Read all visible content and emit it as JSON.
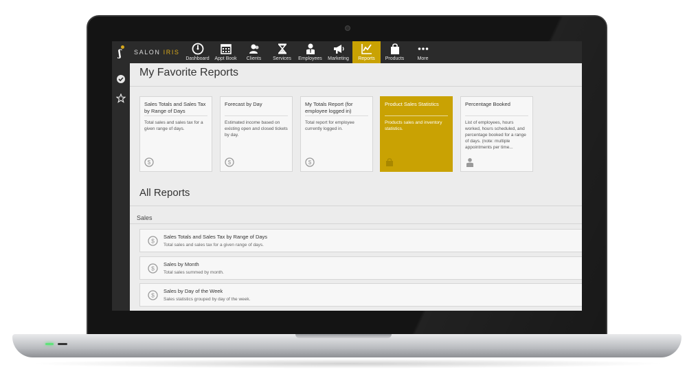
{
  "app": {
    "logo_text": "SALON",
    "logo_accent": "IRIS"
  },
  "nav": [
    {
      "label": "Dashboard",
      "icon": "dashboard-icon"
    },
    {
      "label": "Appt Book",
      "icon": "calendar-icon"
    },
    {
      "label": "Clients",
      "icon": "clients-icon"
    },
    {
      "label": "Services",
      "icon": "hourglass-icon"
    },
    {
      "label": "Employees",
      "icon": "employee-icon"
    },
    {
      "label": "Marketing",
      "icon": "megaphone-icon"
    },
    {
      "label": "Reports",
      "icon": "chart-icon",
      "active": true
    },
    {
      "label": "Products",
      "icon": "shopping-bag-icon"
    },
    {
      "label": "More",
      "icon": "more-dots-icon"
    }
  ],
  "sidebar": [
    "check-circle-icon",
    "star-icon"
  ],
  "favorites": {
    "title": "My Favorite Reports",
    "cards": [
      {
        "title": "Sales Totals and Sales Tax by Range of Days",
        "desc": "Total sales and sales tax for a given range of days.",
        "icon": "dollar-coin-icon"
      },
      {
        "title": "Forecast by Day",
        "desc": "Estimated income based on existing open and closed tickets by day.",
        "icon": "dollar-coin-icon"
      },
      {
        "title": "My Totals Report (for employee logged in)",
        "desc": "Total report for employee currently logged in.",
        "icon": "dollar-coin-icon"
      },
      {
        "title": "Product Sales Statistics",
        "desc": "Products sales and inventory statistics.",
        "icon": "shopping-bag-icon"
      },
      {
        "title": "Percentage Booked",
        "desc": "List of employees, hours worked, hours scheduled, and percentage booked for a range of days. (note: multiple appointments per time...",
        "icon": "employee-icon"
      }
    ]
  },
  "all_reports": {
    "title": "All Reports",
    "section": "Sales",
    "rows": [
      {
        "title": "Sales Totals and Sales Tax by Range of Days",
        "desc": "Total sales and sales tax for a given range of days."
      },
      {
        "title": "Sales by Month",
        "desc": "Total sales summed by month."
      },
      {
        "title": "Sales by Day of the Week",
        "desc": "Sales statistics grouped by day of the week."
      }
    ]
  },
  "colors": {
    "accent": "#c9a203",
    "topbar": "#2b2b2b",
    "background": "#ececec"
  }
}
